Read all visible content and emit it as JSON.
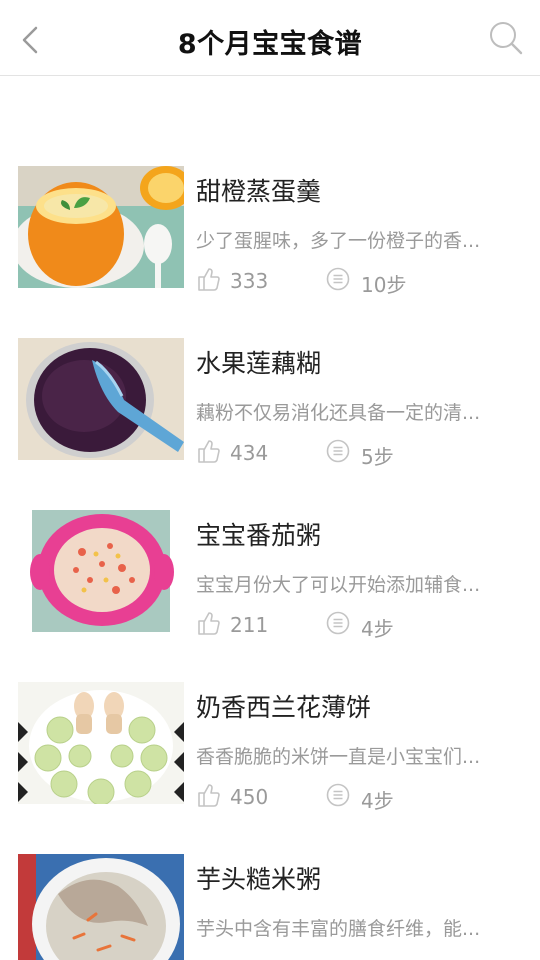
{
  "header": {
    "title": "8个月宝宝食谱",
    "back_icon": "chevron-left-icon",
    "search_icon": "search-icon"
  },
  "recipes": [
    {
      "title": "甜橙蒸蛋羹",
      "desc": "少了蛋腥味，多了一份橙子的香...",
      "likes": "333",
      "steps": "10步"
    },
    {
      "title": "水果莲藕糊",
      "desc": "藕粉不仅易消化还具备一定的清...",
      "likes": "434",
      "steps": "5步"
    },
    {
      "title": "宝宝番茄粥",
      "desc": "宝宝月份大了可以开始添加辅食...",
      "likes": "211",
      "steps": "4步"
    },
    {
      "title": "奶香西兰花薄饼",
      "desc": "香香脆脆的米饼一直是小宝宝们...",
      "likes": "450",
      "steps": "4步"
    },
    {
      "title": "芋头糙米粥",
      "desc": "芋头中含有丰富的膳食纤维，能...",
      "likes": "",
      "steps": ""
    }
  ],
  "colors": {
    "text_primary": "#222222",
    "text_secondary": "#9a9a9a",
    "divider": "#e3e3e3",
    "icon_gray": "#bdbdbd"
  }
}
